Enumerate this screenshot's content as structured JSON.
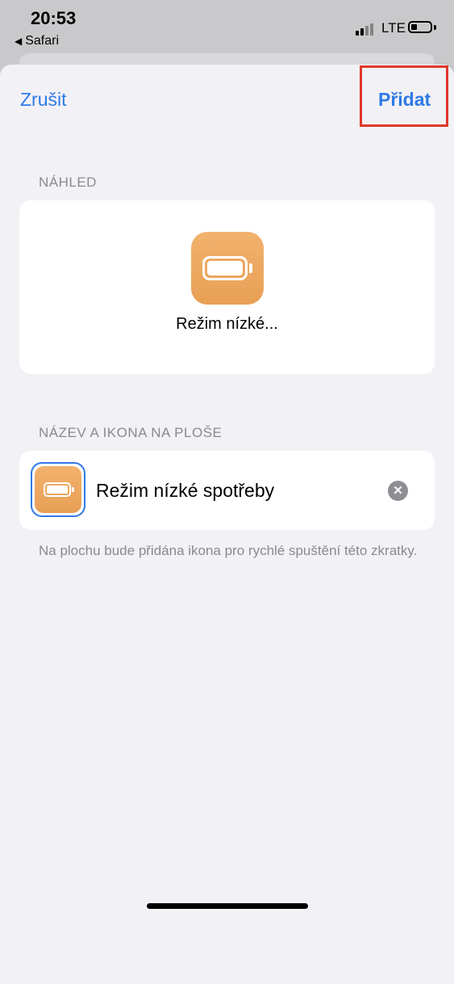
{
  "status_bar": {
    "time": "20:53",
    "back_app": "Safari",
    "network": "LTE",
    "back_arrow": "◀"
  },
  "sheet": {
    "cancel_label": "Zrušit",
    "add_label": "Přidat",
    "preview_header": "NÁHLED",
    "preview_name": "Režim nízké...",
    "name_icon_header": "NÁZEV A IKONA NA PLOŠE",
    "shortcut_name": "Režim nízké spotřeby",
    "clear_symbol": "✕",
    "footer_note": "Na plochu bude přidána ikona pro rychlé spuštění této zkratky."
  },
  "colors": {
    "accent": "#2f7ae5",
    "icon_orange": "#eda45b",
    "highlight_border": "#e0382b"
  },
  "icons": {
    "app_icon": "battery-icon"
  }
}
